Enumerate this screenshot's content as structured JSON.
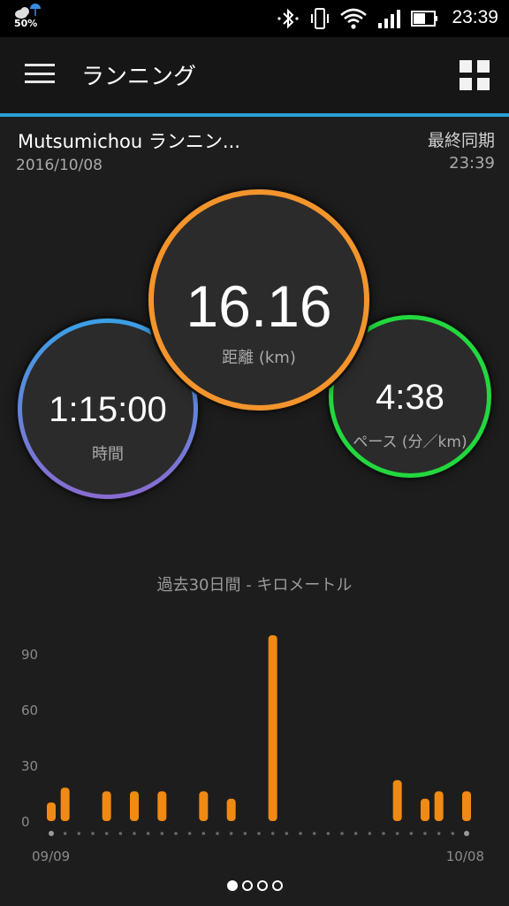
{
  "status_bar": {
    "weather_percent": "50%",
    "time": "23:39",
    "icons": [
      "weather-icon",
      "bluetooth-icon",
      "vibrate-icon",
      "wifi-icon",
      "signal-icon",
      "battery-icon"
    ]
  },
  "app_bar": {
    "title": "ランニング",
    "menu_icon": "hamburger-menu-icon",
    "grid_icon": "grid-view-icon"
  },
  "activity": {
    "name": "Mutsumichou ランニン...",
    "date": "2016/10/08",
    "sync_label": "最終同期",
    "sync_time": "23:39"
  },
  "stats": {
    "distance": {
      "value": "16.16",
      "label": "距離 (km)",
      "color": "#f3942c"
    },
    "time": {
      "value": "1:15:00",
      "label": "時間",
      "color": "#3aa0e6"
    },
    "pace": {
      "value": "4:38",
      "label": "ペース (分／km)",
      "color": "#22d83e"
    }
  },
  "chart_title": "過去30日間 - キロメートル",
  "chart_data": {
    "type": "bar",
    "title": "過去30日間 - キロメートル",
    "yticks": [
      0,
      30,
      60,
      90
    ],
    "ylim": [
      0,
      100
    ],
    "x_start_label": "09/09",
    "x_end_label": "10/08",
    "bar_color": "#f08a12",
    "days": 30,
    "values": [
      10,
      18,
      0,
      0,
      16,
      0,
      16,
      0,
      16,
      0,
      0,
      16,
      0,
      12,
      0,
      0,
      100,
      0,
      0,
      0,
      0,
      0,
      0,
      0,
      0,
      22,
      0,
      12,
      16,
      0,
      16
    ]
  },
  "pager": {
    "pages": 4,
    "active": 0
  }
}
